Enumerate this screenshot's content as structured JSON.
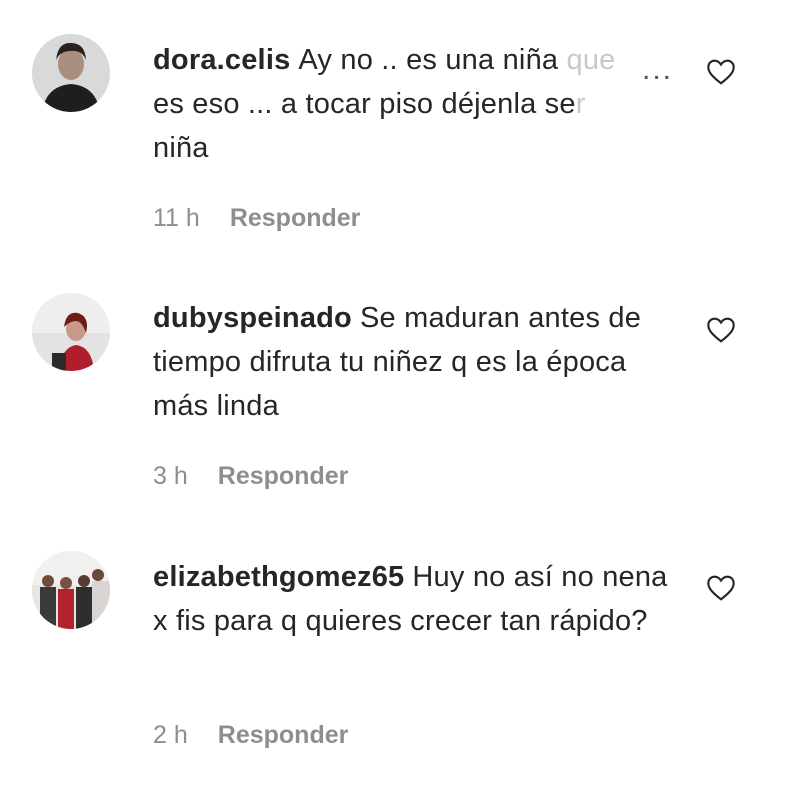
{
  "comments": [
    {
      "username": "dora.celis",
      "text_main": "Ay no .. es una niña ",
      "text_faded": "que",
      "line2_main": "es eso ... a tocar piso déjenla se",
      "line2_faded": "r",
      "line3": "niña",
      "time": "11 h",
      "reply_label": "Responder",
      "more_label": "..."
    },
    {
      "username": "dubyspeinado",
      "text": "Se maduran antes de tiempo difruta tu niñez q es la época más linda",
      "time": "3 h",
      "reply_label": "Responder"
    },
    {
      "username": "elizabethgomez65",
      "text": "Huy no así no nena x fis para q quieres crecer tan rápido?",
      "time": "2 h",
      "reply_label": "Responder"
    }
  ],
  "icons": {
    "heart": "heart-outline-icon",
    "more": "more-options-icon"
  }
}
